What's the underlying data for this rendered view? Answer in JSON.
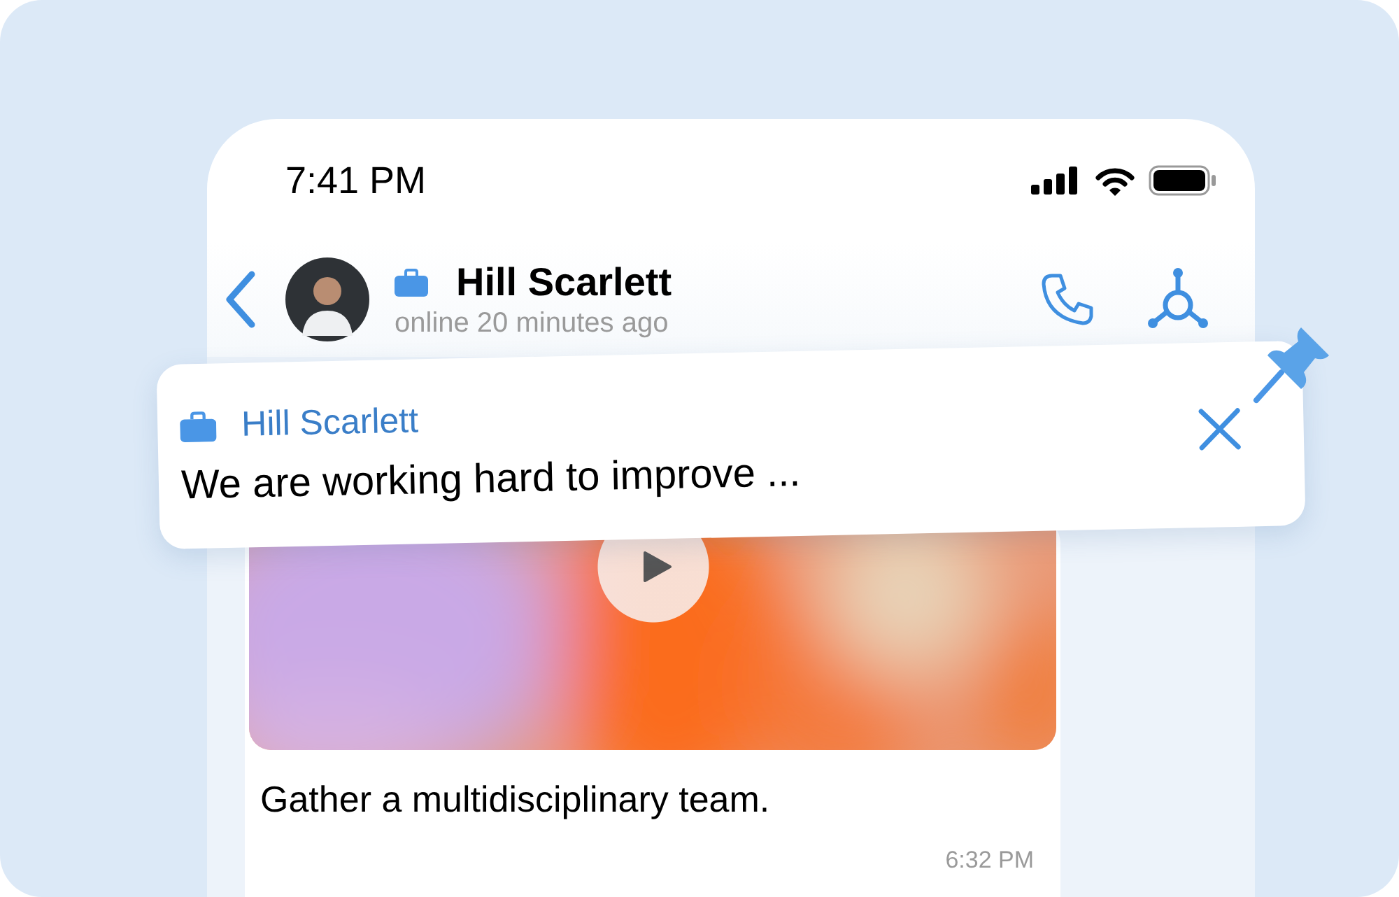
{
  "status_bar": {
    "time": "7:41 PM"
  },
  "header": {
    "name": "Hill Scarlett",
    "status": "online 20 minutes ago"
  },
  "pinned": {
    "sender": "Hill Scarlett",
    "text": "We are working hard to improve ..."
  },
  "message": {
    "text": "Gather a multidisciplinary team.",
    "time": "6:32 PM"
  }
}
